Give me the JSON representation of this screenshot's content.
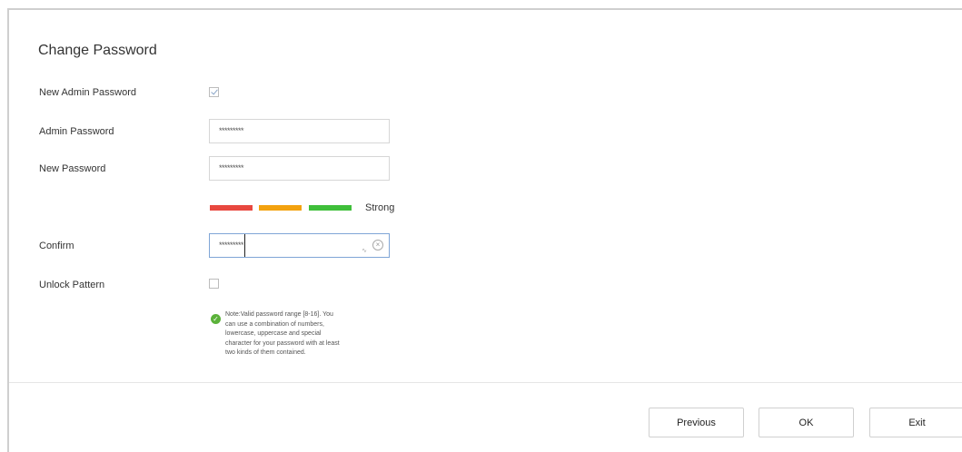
{
  "page": {
    "title": "Change Password"
  },
  "form": {
    "new_admin_password": {
      "label": "New Admin Password",
      "checked": true
    },
    "admin_password": {
      "label": "Admin Password",
      "value": "*********"
    },
    "new_password": {
      "label": "New Password",
      "value": "*********"
    },
    "strength": {
      "label": "Strong",
      "level_fraction": 1.0,
      "colors": [
        "#e8483f",
        "#f3a20f",
        "#3fbf3a"
      ]
    },
    "confirm": {
      "label": "Confirm",
      "value": "*********"
    },
    "unlock_pattern": {
      "label": "Unlock Pattern",
      "checked": false
    }
  },
  "note": {
    "icon": "check-circle-icon",
    "icon_color": "#5bb23a",
    "text": "Note:Valid password range [8-16]. You\ncan use a combination of numbers,\nlowercase, uppercase and special\ncharacter for your password with at least\ntwo kinds of them contained."
  },
  "buttons": {
    "previous": "Previous",
    "ok": "OK",
    "exit": "Exit"
  }
}
